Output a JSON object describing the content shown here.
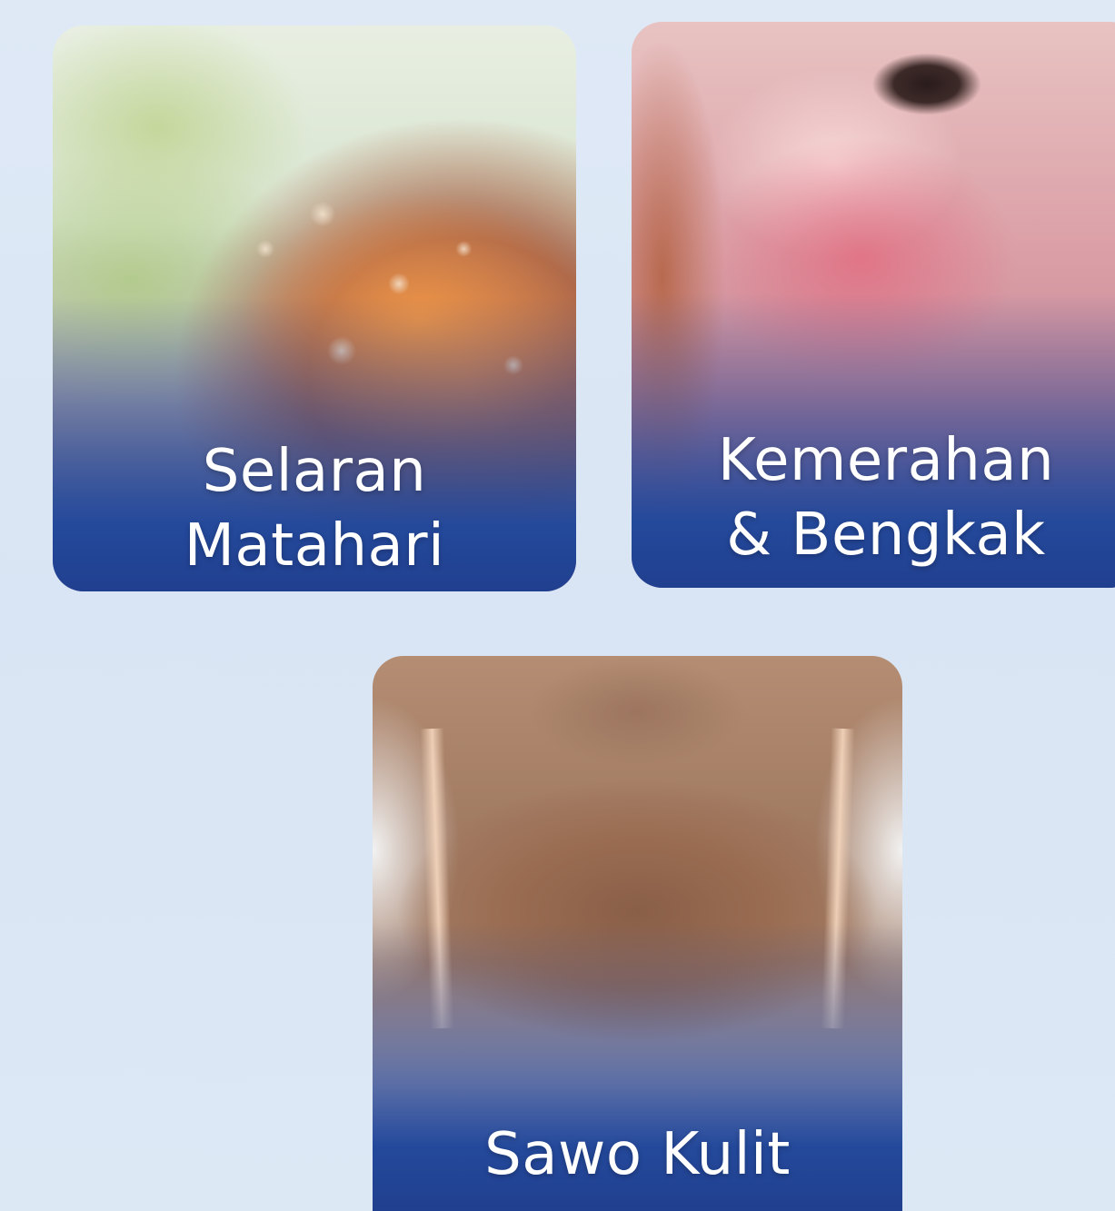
{
  "cards": [
    {
      "label_line1": "Selaran",
      "label_line2": "Matahari"
    },
    {
      "label_line1": "Kemerahan",
      "label_line2": "& Bengkak"
    },
    {
      "label_line1": "Sawo Kulit"
    }
  ],
  "colors": {
    "background": "#dce7f5",
    "label_band": "#24499b",
    "label_text": "#ffffff"
  }
}
